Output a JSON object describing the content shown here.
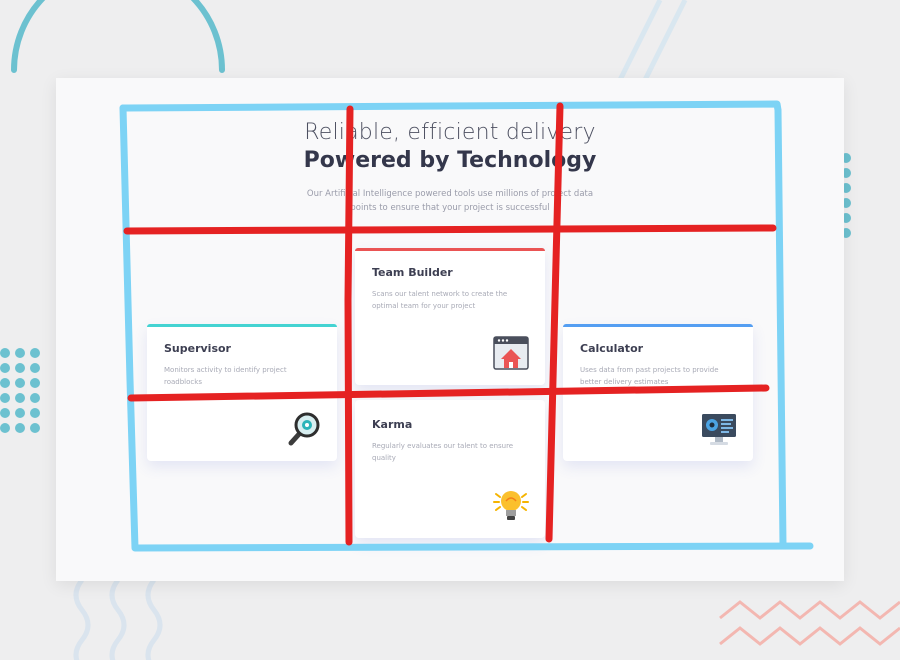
{
  "header": {
    "line1": "Reliable, efficient delivery",
    "line2": "Powered by Technology",
    "subtitle": "Our Artificial Intelligence powered tools use millions of project data points to ensure that your project is successful"
  },
  "cards": [
    {
      "title": "Supervisor",
      "desc": "Monitors activity to identify project roadblocks",
      "accent": "#44d3d2",
      "icon": "magnifier-icon"
    },
    {
      "title": "Team Builder",
      "desc": "Scans our talent network to create the optimal team for your project",
      "accent": "#ea5454",
      "icon": "team-builder-icon"
    },
    {
      "title": "Karma",
      "desc": "Regularly evaluates our talent to ensure quality",
      "accent": "#fcaf4a",
      "icon": "lightbulb-icon"
    },
    {
      "title": "Calculator",
      "desc": "Uses data from past projects to provide better delivery estimates",
      "accent": "#549ef2",
      "icon": "computer-icon"
    }
  ],
  "annotation_colors": {
    "grid_lines": "#e52222",
    "outline": "#7dd3f5"
  }
}
